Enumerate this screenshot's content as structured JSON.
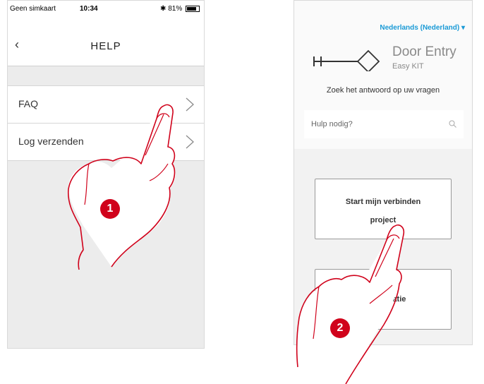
{
  "phone1": {
    "status": {
      "carrier": "Geen simkaart",
      "time": "10:34",
      "battery": "81%"
    },
    "title": "HELP",
    "back_icon": "chevron-left-icon",
    "menu_items": [
      {
        "label": "FAQ"
      },
      {
        "label": "Log verzenden"
      }
    ],
    "step_badge": "1"
  },
  "phone2": {
    "language": "Nederlands (Nederland)",
    "brand_line1": "Door Entry",
    "brand_line2": "Easy KIT",
    "tagline": "Zoek het antwoord op uw vragen",
    "search_placeholder": "Hulp nodig?",
    "button1_line1": "Start mijn verbinden",
    "button1_line2": "project",
    "button2_partial": "Configuratie",
    "step_badge": "2"
  },
  "colors": {
    "accent": "#d0021b",
    "link_blue": "#1a9ad6"
  }
}
